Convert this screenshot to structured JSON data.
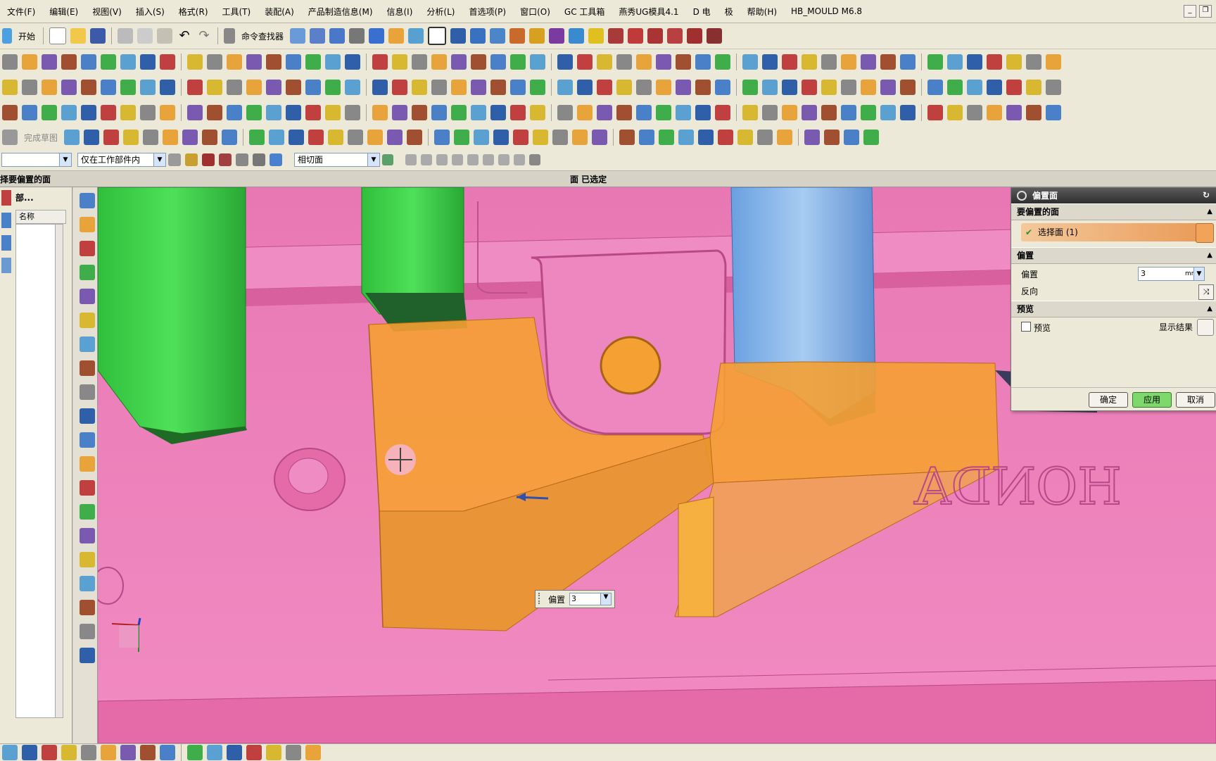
{
  "menu": [
    "文件(F)",
    "编辑(E)",
    "视图(V)",
    "插入(S)",
    "格式(R)",
    "工具(T)",
    "装配(A)",
    "产品制造信息(M)",
    "信息(I)",
    "分析(L)",
    "首选项(P)",
    "窗口(O)",
    "GC 工具箱",
    "燕秀UG模具4.1",
    "D 电",
    "极",
    "帮助(H)",
    "HB_MOULD M6.8"
  ],
  "toolbar": {
    "start_label": "开始",
    "command_finder_label": "命令查找器",
    "sketch_finish_label": "完成草图"
  },
  "filterbar": {
    "scope_value": "仅在工作部件内",
    "face_rule_value": "相切面"
  },
  "cue": {
    "prompt": "择要偏置的面",
    "status": "面 已选定"
  },
  "navigator": {
    "header": "部...",
    "column_name": "名称"
  },
  "viewport": {
    "embossed_text": "HONDA",
    "colors": {
      "base": "#ee7bb8",
      "selected_face": "#f5a032",
      "green_body": "#3fd04a",
      "blue_body": "#7fb0e8"
    }
  },
  "dialog": {
    "title": "偏置面",
    "group_faces": "要偏置的面",
    "select_face_label": "选择面 (1)",
    "group_offset": "偏置",
    "offset_label": "偏置",
    "offset_value": "3",
    "offset_unit": "mm",
    "reverse_label": "反向",
    "group_preview": "预览",
    "preview_label": "预览",
    "show_result_label": "显示结果",
    "ok": "确定",
    "apply": "应用",
    "cancel": "取消"
  },
  "floating_input": {
    "label": "偏置",
    "value": "3"
  }
}
